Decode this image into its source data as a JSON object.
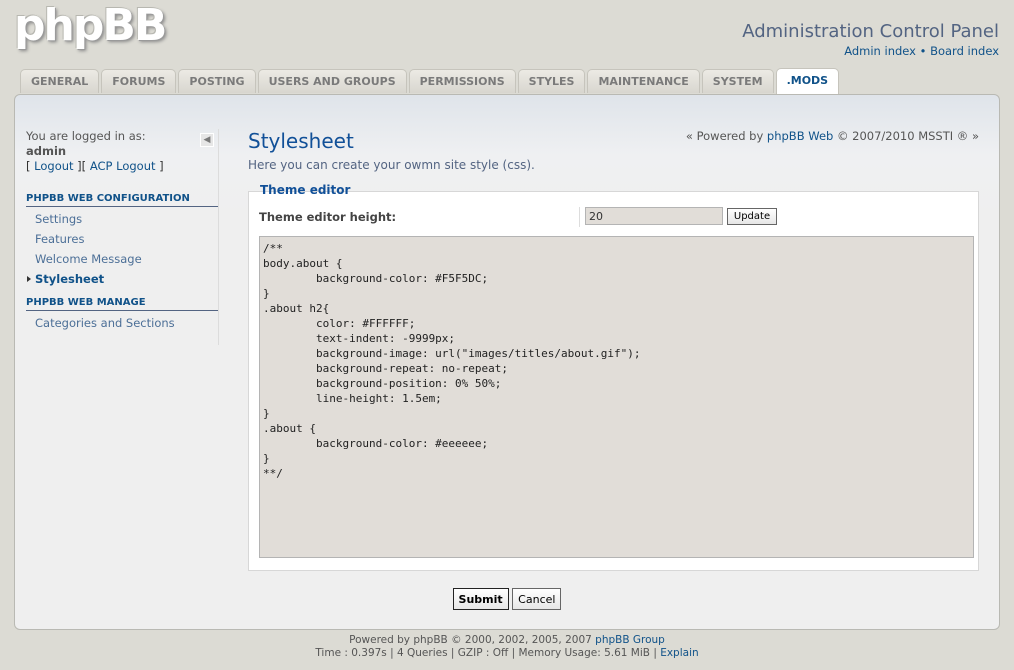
{
  "header": {
    "logo_text": "phpBB",
    "title": "Administration Control Panel",
    "admin_index": "Admin index",
    "separator": "•",
    "board_index": "Board index"
  },
  "tabs": [
    {
      "label": "GENERAL",
      "active": false
    },
    {
      "label": "FORUMS",
      "active": false
    },
    {
      "label": "POSTING",
      "active": false
    },
    {
      "label": "USERS AND GROUPS",
      "active": false
    },
    {
      "label": "PERMISSIONS",
      "active": false
    },
    {
      "label": "STYLES",
      "active": false
    },
    {
      "label": "MAINTENANCE",
      "active": false
    },
    {
      "label": "SYSTEM",
      "active": false
    },
    {
      "label": ".MODS",
      "active": true
    }
  ],
  "menu": {
    "logged_in_as": "You are logged in as:",
    "username": "admin",
    "logout_open": "[ ",
    "logout": "Logout",
    "links_mid": " ][ ",
    "acp_logout": "ACP Logout",
    "links_close": " ]",
    "collapse_icon": "◀",
    "section1_title": "PHPBB WEB CONFIGURATION",
    "section1_items": [
      "Settings",
      "Features",
      "Welcome Message",
      "Stylesheet"
    ],
    "section2_title": "PHPBB WEB MANAGE",
    "section2_items": [
      "Categories and Sections"
    ]
  },
  "main": {
    "title": "Stylesheet",
    "description": "Here you can create your owmn site style (css).",
    "powered_prefix": "« Powered by ",
    "powered_link": "phpBB Web",
    "powered_suffix": " © 2007/2010 MSSTI ® »",
    "legend": "Theme editor",
    "height_label": "Theme editor height:",
    "height_value": "20",
    "update_label": "Update",
    "css_content": "/**\nbody.about {\n        background-color: #F5F5DC;\n}\n.about h2{\n        color: #FFFFFF;\n        text-indent: -9999px;\n        background-image: url(\"images/titles/about.gif\");\n        background-repeat: no-repeat;\n        background-position: 0% 50%;\n        line-height: 1.5em;\n}\n.about {\n        background-color: #eeeeee;\n}\n**/",
    "submit_label": "Submit",
    "cancel_label": "Cancel"
  },
  "footer": {
    "powered_prefix": "Powered by phpBB © 2000, 2002, 2005, 2007 ",
    "powered_link": "phpBB Group",
    "stats": "Time : 0.397s | 4 Queries | GZIP : Off | Memory Usage: 5.61 MiB | ",
    "explain": "Explain"
  }
}
